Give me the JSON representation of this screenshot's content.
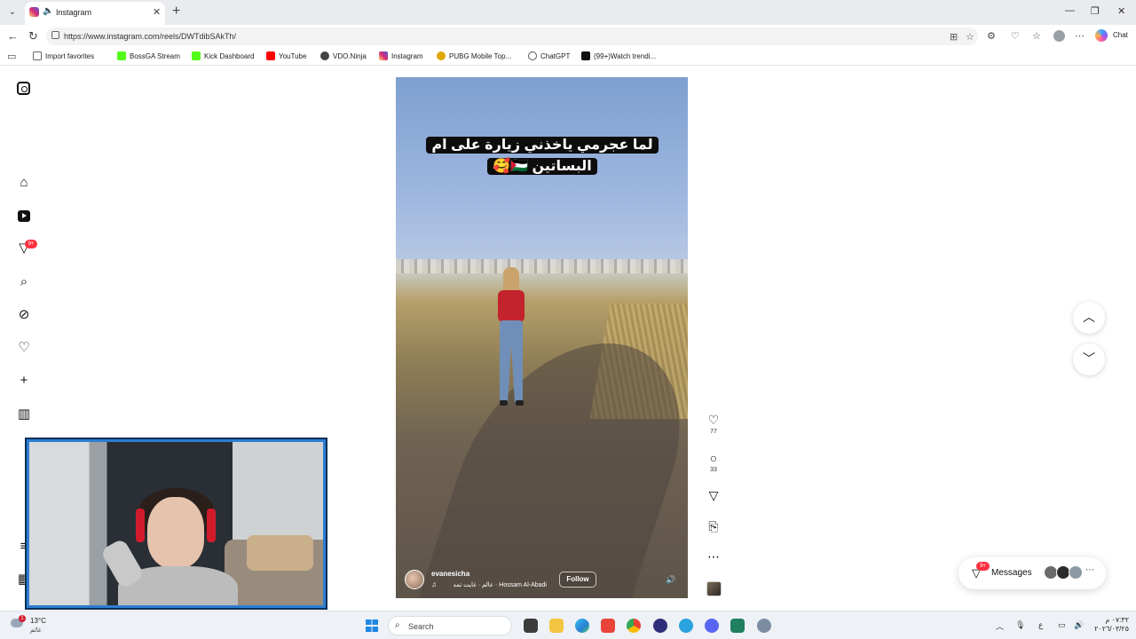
{
  "browser": {
    "tab_title": "Instagram",
    "url": "https://www.instagram.com/reels/DWTdibSAkTh/",
    "chat_label": "Chat",
    "bookmarks": [
      "Import favorites",
      "BossGA Stream",
      "Kick Dashboard",
      "YouTube",
      "VDO.Ninja",
      "Instagram",
      "PUBG Mobile Top...",
      "ChatGPT",
      "(99+)Watch trendi..."
    ]
  },
  "sidebar": {
    "notifications_badge": "9+"
  },
  "reel": {
    "caption": "لما عجرمي ياخذني زيارة على ام البساتين 🇵🇸🥰",
    "username": "evanesicha",
    "audio": "Hossam Al-Abadi · عالم · غايت تمد",
    "follow_label": "Follow",
    "likes": "77",
    "comments": "33"
  },
  "messages": {
    "label": "Messages",
    "badge": "9+"
  },
  "taskbar": {
    "weather_badge": "1",
    "temperature": "13°C",
    "weather_text": "غائم",
    "search_placeholder": "Search",
    "ime_indicator": "ع",
    "clock_time": "٠٧:٣٢ م",
    "clock_date": "٢٠٢٦/٠٣/٢٥"
  },
  "colors": {
    "badge_red": "#ff3040",
    "webcam_border": "#2d7dd2",
    "shirt_red": "#c3232c"
  }
}
